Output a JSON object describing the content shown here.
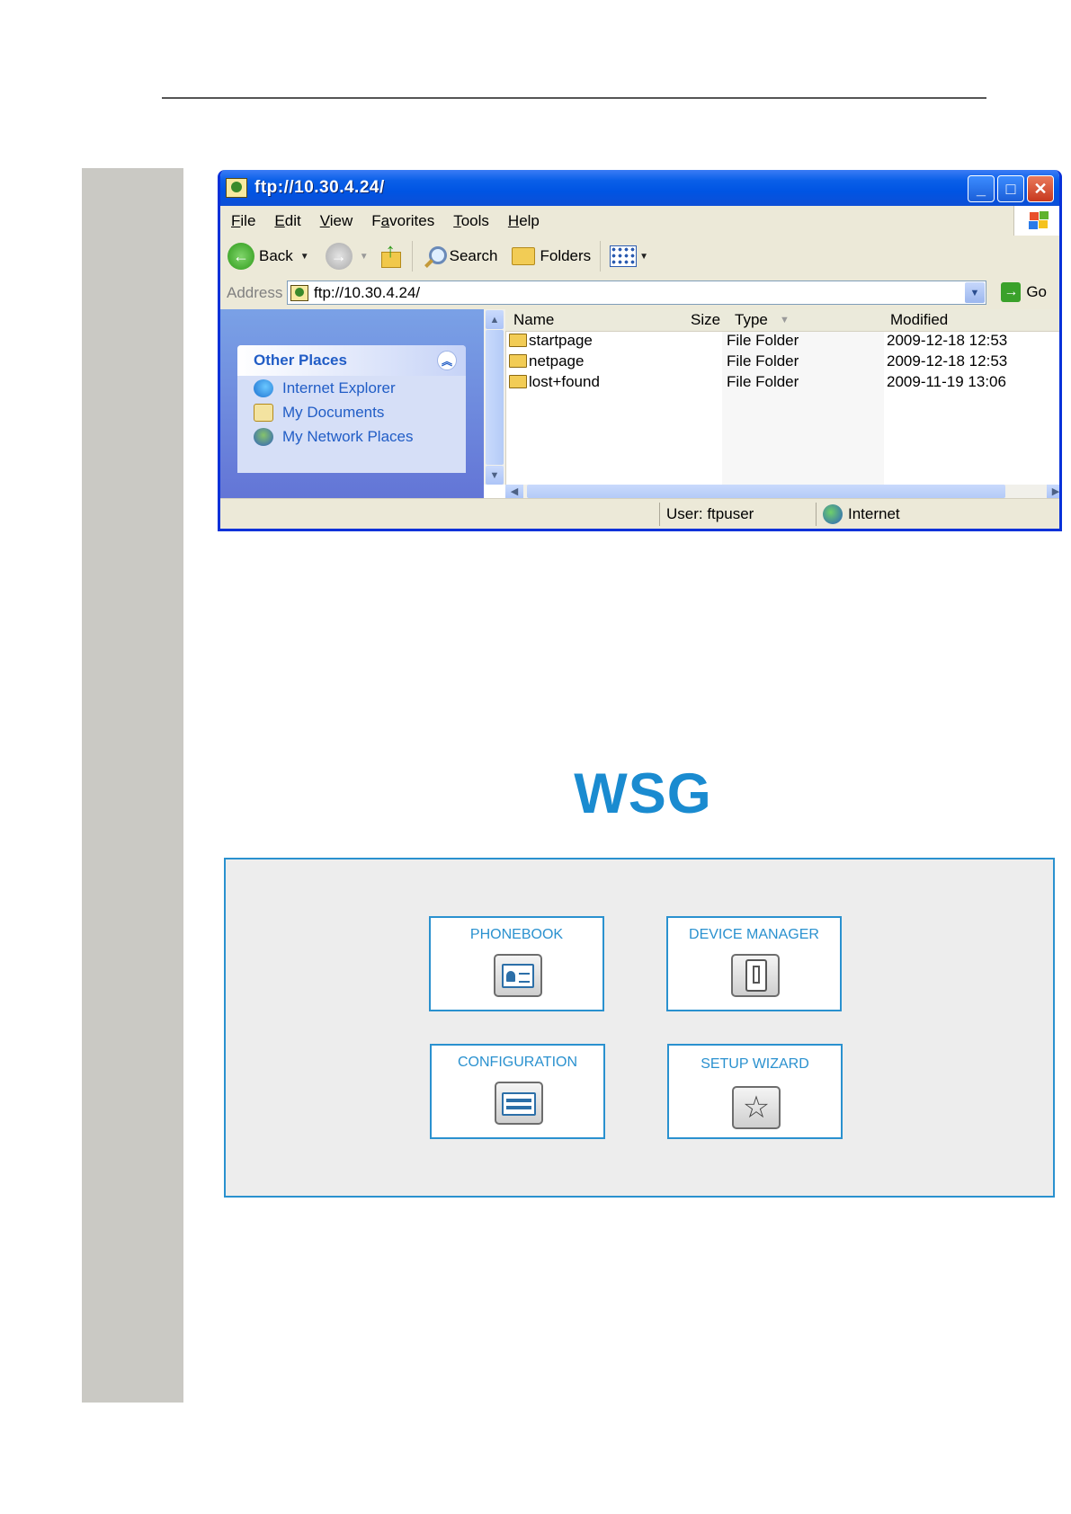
{
  "explorer": {
    "title": "ftp://10.30.4.24/",
    "menu": [
      {
        "label": "File",
        "accel": "F",
        "rest": "ile"
      },
      {
        "label": "Edit",
        "accel": "E",
        "rest": "dit"
      },
      {
        "label": "View",
        "accel": "V",
        "rest": "iew"
      },
      {
        "label": "Favorites",
        "accel": "a",
        "pre": "F",
        "rest": "vorites"
      },
      {
        "label": "Tools",
        "accel": "T",
        "rest": "ools"
      },
      {
        "label": "Help",
        "accel": "H",
        "rest": "elp"
      }
    ],
    "toolbar": {
      "back_label": "Back",
      "search_label": "Search",
      "folders_label": "Folders"
    },
    "address": {
      "label": "Address",
      "value": "ftp://10.30.4.24/",
      "go_label": "Go"
    },
    "other_places": {
      "title": "Other Places",
      "links": [
        "Internet Explorer",
        "My Documents",
        "My Network Places"
      ]
    },
    "columns": {
      "name": "Name",
      "size": "Size",
      "type": "Type",
      "modified": "Modified"
    },
    "files": [
      {
        "name": "startpage",
        "type": "File Folder",
        "modified": "2009-12-18 12:53"
      },
      {
        "name": "netpage",
        "type": "File Folder",
        "modified": "2009-12-18 12:53"
      },
      {
        "name": "lost+found",
        "type": "File Folder",
        "modified": "2009-11-19 13:06"
      }
    ],
    "status": {
      "user": "User: ftpuser",
      "zone": "Internet"
    }
  },
  "wsg": {
    "title": "WSG",
    "tiles": {
      "phonebook": "PHONEBOOK",
      "device_manager": "DEVICE MANAGER",
      "configuration": "CONFIGURATION",
      "setup_wizard": "SETUP WIZARD"
    }
  },
  "colors": {
    "accent": "#2a91cf",
    "wsg_title": "#1a8bd0",
    "xp_titlebar": "#0054e3",
    "sidebar_grey": "#cac9c4"
  }
}
